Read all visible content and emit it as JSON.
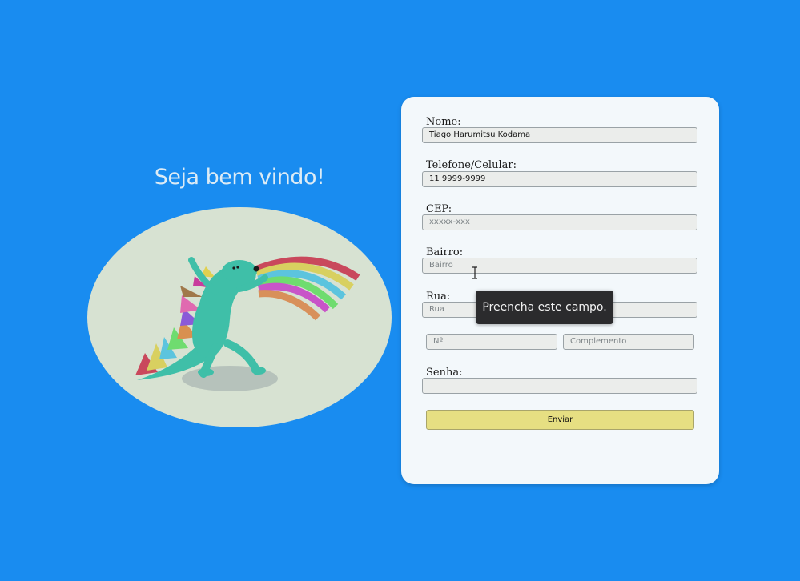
{
  "welcome": "Seja bem vindo!",
  "form": {
    "nome_label": "Nome:",
    "nome_value": "Tiago Harumitsu Kodama",
    "telefone_label": "Telefone/Celular:",
    "telefone_value": "11 9999-9999",
    "cep_label": "CEP:",
    "cep_placeholder": "xxxxx-xxx",
    "bairro_label": "Bairro:",
    "bairro_placeholder": "Bairro",
    "rua_label": "Rua:",
    "rua_placeholder": "Rua",
    "numero_placeholder": "Nº",
    "complemento_placeholder": "Complemento",
    "senha_label": "Senha:",
    "submit_label": "Enviar"
  },
  "tooltip": "Preencha este campo.",
  "colors": {
    "background": "#198cf0",
    "card": "#f3f8fb",
    "button": "#e6df82",
    "hero": "#d7e2d2",
    "dino": "#3fbfa8"
  },
  "icons": {
    "cursor": "text-cursor-icon",
    "illustration": "rainbow-dinosaur-illustration"
  }
}
